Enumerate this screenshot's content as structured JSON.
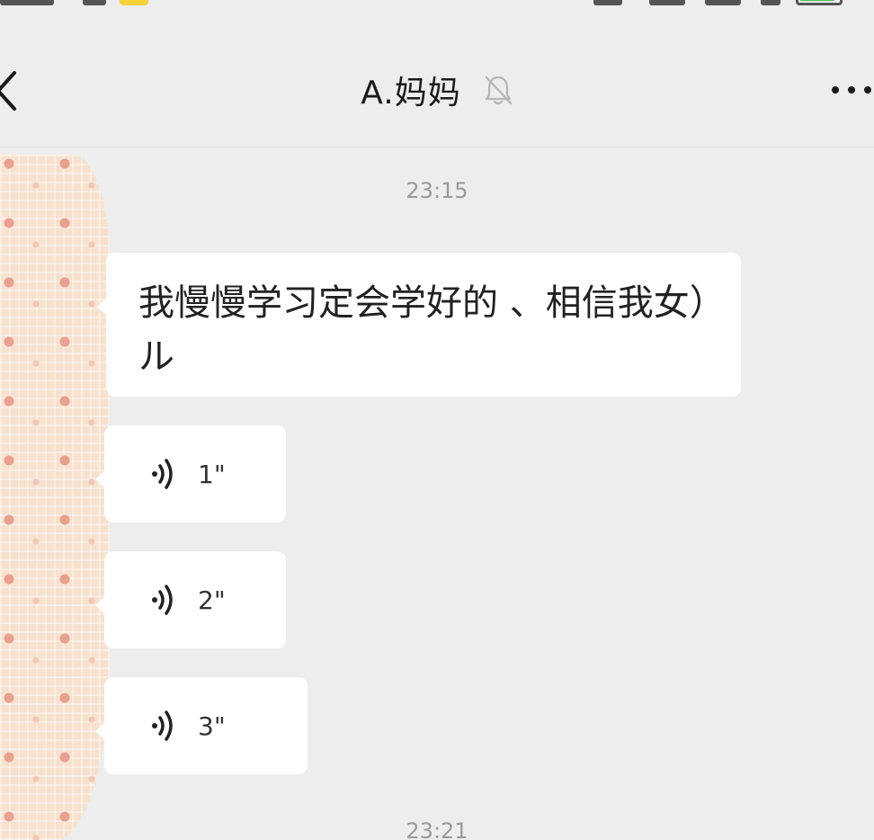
{
  "header": {
    "title": "A.妈妈",
    "back_icon": "chevron-left-icon",
    "mute_icon": "bell-off-icon",
    "more_icon": "more-horizontal-icon"
  },
  "messages": {
    "timestamp_1": "23:15",
    "text_1": "我慢慢学习定会学好的 、相信我女）ル",
    "voice_1": "1\"",
    "voice_2": "2\"",
    "voice_3": "3\"",
    "timestamp_2": "23:21"
  },
  "colors": {
    "background": "#ededed",
    "bubble": "#ffffff",
    "timestamp": "#9a9a9a"
  }
}
